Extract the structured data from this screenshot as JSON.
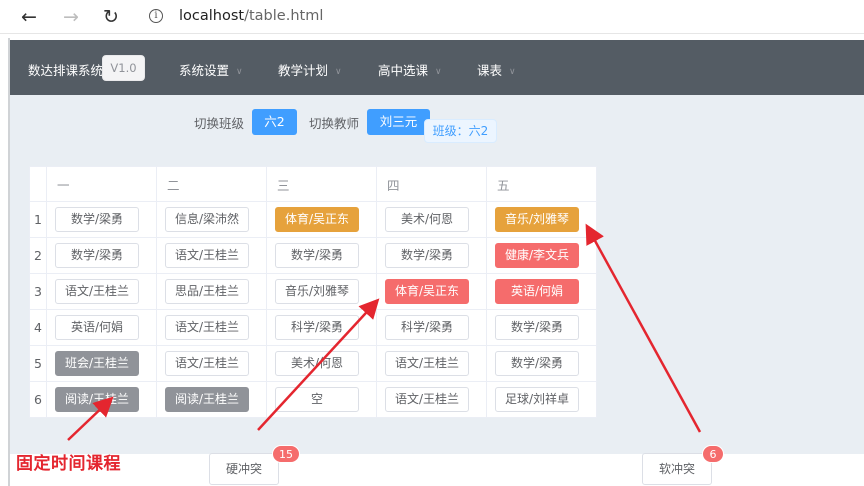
{
  "browser": {
    "back_glyph": "←",
    "forward_glyph": "→",
    "reload_glyph": "↻",
    "info_glyph": "i",
    "url_host": "localhost",
    "url_path": "/table.html"
  },
  "nav": {
    "brand": "数达排课系统",
    "version": "V1.0",
    "menu": [
      "系统设置",
      "教学计划",
      "高中选课",
      "课表"
    ],
    "chevron": "∨"
  },
  "toolbar": {
    "switch_class_label": "切换班级",
    "class_value": "六2",
    "switch_teacher_label": "切换教师",
    "teacher_value": "刘三元",
    "class_tag": "班级：六2"
  },
  "schedule": {
    "days": [
      "一",
      "二",
      "三",
      "四",
      "五"
    ],
    "rows": [
      {
        "num": "1",
        "cells": [
          {
            "text": "数学/梁勇",
            "style": "default"
          },
          {
            "text": "信息/梁沛然",
            "style": "default"
          },
          {
            "text": "体育/吴正东",
            "style": "orange"
          },
          {
            "text": "美术/何恩",
            "style": "default"
          },
          {
            "text": "音乐/刘雅琴",
            "style": "orange"
          }
        ]
      },
      {
        "num": "2",
        "cells": [
          {
            "text": "数学/梁勇",
            "style": "default"
          },
          {
            "text": "语文/王桂兰",
            "style": "default"
          },
          {
            "text": "数学/梁勇",
            "style": "default"
          },
          {
            "text": "数学/梁勇",
            "style": "default"
          },
          {
            "text": "健康/李文兵",
            "style": "red"
          }
        ]
      },
      {
        "num": "3",
        "cells": [
          {
            "text": "语文/王桂兰",
            "style": "default"
          },
          {
            "text": "思品/王桂兰",
            "style": "default"
          },
          {
            "text": "音乐/刘雅琴",
            "style": "default"
          },
          {
            "text": "体育/吴正东",
            "style": "red"
          },
          {
            "text": "英语/何娟",
            "style": "red"
          }
        ]
      },
      {
        "num": "4",
        "cells": [
          {
            "text": "英语/何娟",
            "style": "default"
          },
          {
            "text": "语文/王桂兰",
            "style": "default"
          },
          {
            "text": "科学/梁勇",
            "style": "default"
          },
          {
            "text": "科学/梁勇",
            "style": "default"
          },
          {
            "text": "数学/梁勇",
            "style": "default"
          }
        ]
      },
      {
        "num": "5",
        "cells": [
          {
            "text": "班会/王桂兰",
            "style": "gray"
          },
          {
            "text": "语文/王桂兰",
            "style": "default"
          },
          {
            "text": "美术/何恩",
            "style": "default"
          },
          {
            "text": "语文/王桂兰",
            "style": "default"
          },
          {
            "text": "数学/梁勇",
            "style": "default"
          }
        ]
      },
      {
        "num": "6",
        "cells": [
          {
            "text": "阅读/王桂兰",
            "style": "gray"
          },
          {
            "text": "阅读/王桂兰",
            "style": "gray"
          },
          {
            "text": "空",
            "style": "default"
          },
          {
            "text": "语文/王桂兰",
            "style": "default"
          },
          {
            "text": "足球/刘祥卓",
            "style": "default"
          }
        ]
      }
    ]
  },
  "conflicts": {
    "hard_label": "硬冲突",
    "hard_count": "15",
    "soft_label": "软冲突",
    "soft_count": "6"
  },
  "annotation": {
    "text": "固定时间课程"
  },
  "colors": {
    "nav_bg": "#545c64",
    "primary": "#409eff",
    "warning": "#e6a23c",
    "danger": "#f56c6c",
    "info": "#909399",
    "annotation_red": "#e4262f"
  }
}
